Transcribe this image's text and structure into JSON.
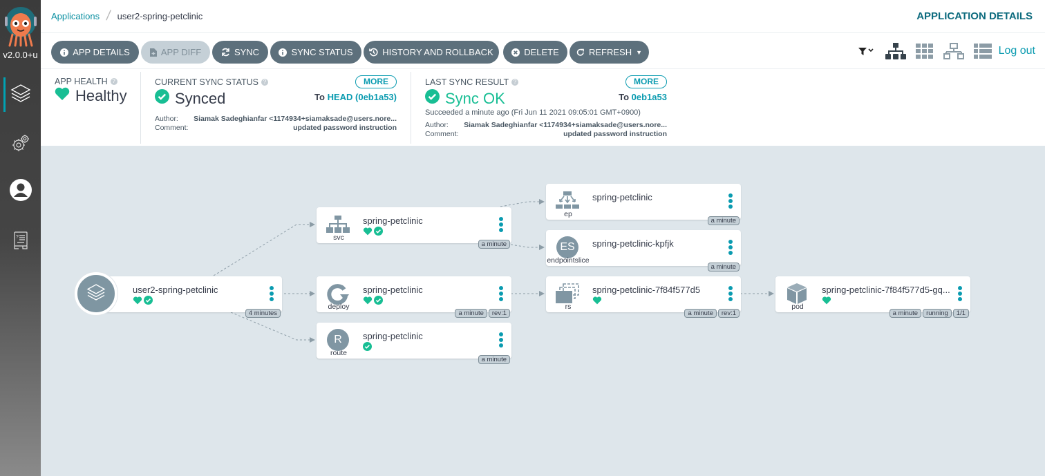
{
  "sidebar": {
    "version": "v2.0.0+u",
    "items": [
      {
        "name": "applications",
        "icon": "layers-icon",
        "active": true
      },
      {
        "name": "settings",
        "icon": "gears-icon",
        "active": false
      },
      {
        "name": "user-info",
        "icon": "user-icon",
        "active": false
      },
      {
        "name": "documentation",
        "icon": "docs-icon",
        "active": false
      }
    ]
  },
  "header": {
    "breadcrumb_root": "Applications",
    "breadcrumb_current": "user2-spring-petclinic",
    "page_title": "APPLICATION DETAILS"
  },
  "toolbar": {
    "buttons": [
      {
        "label": "APP DETAILS",
        "icon": "info-icon",
        "disabled": false
      },
      {
        "label": "APP DIFF",
        "icon": "file-diff-icon",
        "disabled": true
      },
      {
        "label": "SYNC",
        "icon": "sync-icon",
        "disabled": false
      },
      {
        "label": "SYNC STATUS",
        "icon": "info-icon",
        "disabled": false
      },
      {
        "label": "HISTORY AND ROLLBACK",
        "icon": "history-icon",
        "disabled": false
      },
      {
        "label": "DELETE",
        "icon": "times-circle-icon",
        "disabled": false
      },
      {
        "label": "REFRESH",
        "icon": "redo-icon",
        "disabled": false
      }
    ],
    "logout_label": "Log out"
  },
  "status": {
    "app_health": {
      "label": "APP HEALTH",
      "value": "Healthy"
    },
    "current_sync": {
      "label": "CURRENT SYNC STATUS",
      "value": "Synced",
      "more_label": "MORE",
      "to_prefix": "To",
      "revision": "HEAD (0eb1a53)",
      "author_label": "Author:",
      "author": "Siamak Sadeghianfar <1174934+siamaksade@users.nore...",
      "comment_label": "Comment:",
      "comment": "updated password instruction"
    },
    "last_sync": {
      "label": "LAST SYNC RESULT",
      "value": "Sync OK",
      "more_label": "MORE",
      "to_prefix": "To",
      "revision": "0eb1a53",
      "succeeded": "Succeeded a minute ago (Fri Jun 11 2021 09:05:01 GMT+0900)",
      "author_label": "Author:",
      "author": "Siamak Sadeghianfar <1174934+siamaksade@users.nore...",
      "comment_label": "Comment:",
      "comment": "updated password instruction"
    }
  },
  "colors": {
    "accent": "#0a9bb0",
    "healthy": "#18be94",
    "button": "#5d707c",
    "canvas": "#dee6eb"
  },
  "tree": {
    "app": {
      "name": "user2-spring-petclinic",
      "tags": [
        "4 minutes"
      ],
      "health": true,
      "synced": true
    },
    "nodes": [
      {
        "id": "svc",
        "kind": "svc",
        "name": "spring-petclinic",
        "tags": [
          "a minute"
        ],
        "health": true,
        "synced": true
      },
      {
        "id": "deploy",
        "kind": "deploy",
        "name": "spring-petclinic",
        "tags": [
          "a minute",
          "rev:1"
        ],
        "health": true,
        "synced": true
      },
      {
        "id": "route",
        "kind": "route",
        "name": "spring-petclinic",
        "tags": [
          "a minute"
        ],
        "health": false,
        "synced": true
      },
      {
        "id": "ep",
        "kind": "ep",
        "name": "spring-petclinic",
        "tags": [
          "a minute"
        ],
        "health": false,
        "synced": false
      },
      {
        "id": "es",
        "kind": "endpointslice",
        "name": "spring-petclinic-kpfjk",
        "tags": [
          "a minute"
        ],
        "health": false,
        "synced": false
      },
      {
        "id": "rs",
        "kind": "rs",
        "name": "spring-petclinic-7f84f577d5",
        "tags": [
          "a minute",
          "rev:1"
        ],
        "health": true,
        "synced": false
      },
      {
        "id": "pod",
        "kind": "pod",
        "name": "spring-petclinic-7f84f577d5-gq...",
        "tags": [
          "a minute",
          "running",
          "1/1"
        ],
        "health": true,
        "synced": false
      }
    ],
    "route_letter": "R",
    "es_letters": "ES"
  }
}
